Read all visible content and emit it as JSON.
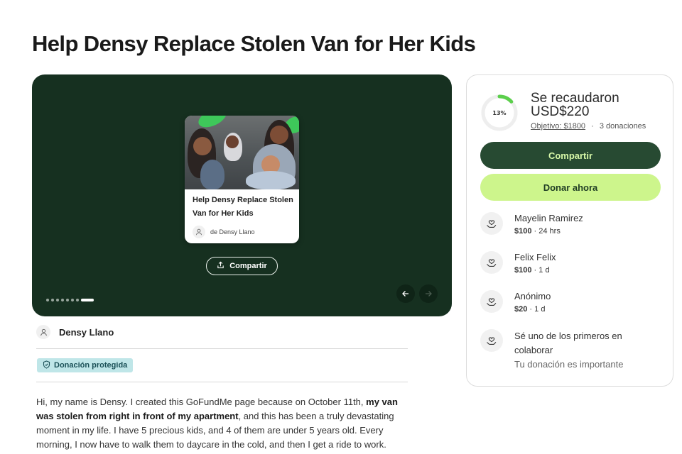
{
  "page": {
    "title": "Help Densy Replace Stolen Van for Her Kids"
  },
  "hero": {
    "card_title": "Help Densy Replace Stolen Van for Her Kids",
    "card_author": "de Densy Llano",
    "share_label": "Compartir",
    "slide_count": 8,
    "active_slide": 8
  },
  "organizer": {
    "name": "Densy Llano",
    "protected_label": "Donación protegida"
  },
  "story": {
    "part1": "Hi, my name is Densy. I created this GoFundMe page because on October 11th, ",
    "bold": "my van was stolen from right in front of my apartment",
    "part2": ", and this has been a truly devastating moment in my life. I have 5 precious kids, and 4 of them are under 5 years old. Every morning, I now have to walk them to daycare in the cold, and then I get a ride to work."
  },
  "panel": {
    "percent": "13%",
    "progress_fraction": 0.13,
    "raised_line1": "Se recaudaron",
    "raised_line2": "USD$220",
    "goal": "Objetivo: $1800",
    "separator": "·",
    "donations_count": "3 donaciones",
    "share_button": "Compartir",
    "donate_button": "Donar ahora",
    "donations": [
      {
        "name": "Mayelin Ramirez",
        "amount": "$100",
        "time": "· 24 hrs"
      },
      {
        "name": "Felix Felix",
        "amount": "$100",
        "time": "· 1 d"
      },
      {
        "name": "Anónimo",
        "amount": "$20",
        "time": "· 1 d"
      }
    ],
    "cta_title": "Sé uno de los primeros en colaborar",
    "cta_subtitle": "Tu donación es importante"
  },
  "colors": {
    "hero_bg": "#163020",
    "share_btn_bg": "#274a32",
    "share_btn_text": "#d7f7a8",
    "donate_btn_bg": "#cdf58c",
    "progress": "#5ccf4c",
    "badge_bg": "#bfe6e8"
  },
  "icons": {
    "share": "share-icon",
    "user": "user-icon",
    "shield": "shield-icon",
    "hand_heart": "hand-heart-icon",
    "arrow_left": "arrow-left-icon",
    "arrow_right": "arrow-right-icon"
  }
}
